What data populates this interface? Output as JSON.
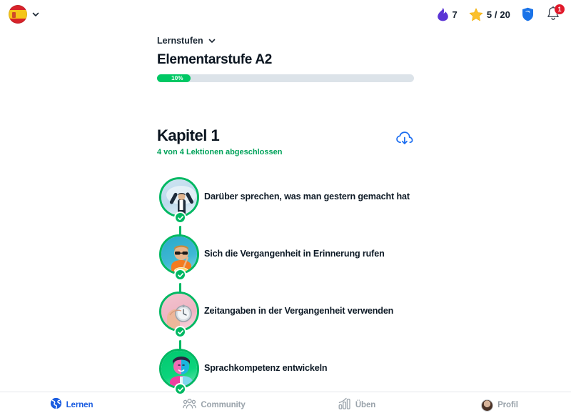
{
  "topbar": {
    "language": {
      "name": "spanish-flag",
      "label": "Español",
      "chevron": "chevron-down-icon"
    },
    "streak": {
      "icon": "flame-icon",
      "value": "7",
      "color": "#5b35d5"
    },
    "points": {
      "icon": "star-icon",
      "value": "5 / 20",
      "color": "#fbc02d"
    },
    "shield": {
      "icon": "shield-icon",
      "color": "#1a73e8"
    },
    "notifications": {
      "icon": "bell-icon",
      "badge": "1",
      "badge_color": "#e1192a"
    }
  },
  "level": {
    "breadcrumb_label": "Lernstufen",
    "title": "Elementarstufe A2",
    "progress_percent": 10,
    "progress_label": "10%",
    "progress_fill_color": "#00c864",
    "progress_track_color": "#dce3e9"
  },
  "chapter": {
    "title": "Kapitel 1",
    "subtitle": "4 von 4 Lektionen abgeschlossen",
    "subtitle_color": "#00a25a",
    "download_icon": "cloud-download-icon",
    "download_color": "#1a6cf0"
  },
  "lessons": [
    {
      "title": "Darüber sprechen, was man gestern gemacht hat",
      "completed": true,
      "thumbnail": "person-arms-raised-thumbnail"
    },
    {
      "title": "Sich die Vergangenheit in Erinnerung rufen",
      "completed": true,
      "thumbnail": "person-orange-shirt-thumbnail"
    },
    {
      "title": "Zeitangaben in der Vergangenheit verwenden",
      "completed": true,
      "thumbnail": "hand-stopwatch-thumbnail"
    },
    {
      "title": "Sprachkompetenz entwickeln",
      "completed": true,
      "thumbnail": "woman-duotone-thumbnail"
    }
  ],
  "bottom_nav": {
    "active_color": "#1a5ce0",
    "inactive_color": "#9aa3ab",
    "items": [
      {
        "label": "Lernen",
        "icon": "globe-icon",
        "active": true
      },
      {
        "label": "Community",
        "icon": "people-icon",
        "active": false
      },
      {
        "label": "Üben",
        "icon": "bar-chart-icon",
        "active": false
      },
      {
        "label": "Profil",
        "icon": "avatar-icon",
        "active": false
      }
    ]
  }
}
